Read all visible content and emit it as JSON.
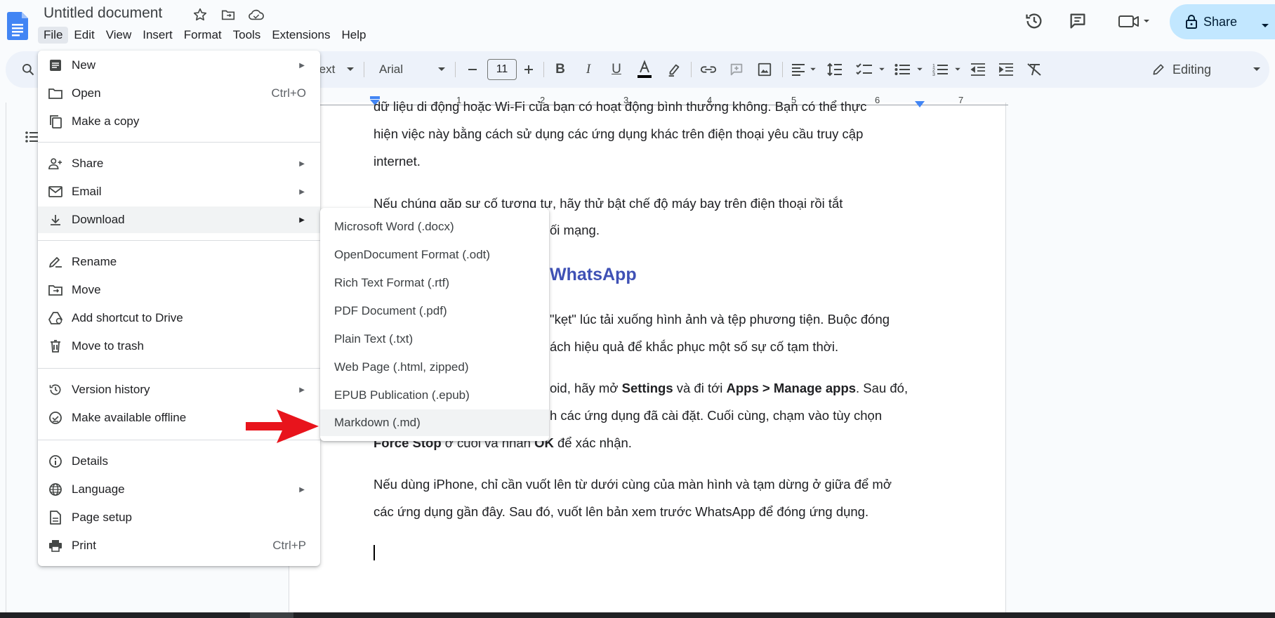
{
  "header": {
    "doc_title": "Untitled document",
    "menus": [
      "File",
      "Edit",
      "View",
      "Insert",
      "Format",
      "Tools",
      "Extensions",
      "Help"
    ],
    "share_label": "Share"
  },
  "toolbar": {
    "style_partial": "ext",
    "font_name": "Arial",
    "font_size": "11",
    "editing_label": "Editing"
  },
  "ruler": {
    "numbers": [
      "1",
      "2",
      "3",
      "4",
      "5",
      "6",
      "7"
    ]
  },
  "file_menu": {
    "items": [
      {
        "label": "New",
        "icon": "document-icon",
        "submenu": true
      },
      {
        "label": "Open",
        "icon": "folder-icon",
        "shortcut": "Ctrl+O"
      },
      {
        "label": "Make a copy",
        "icon": "copy-icon"
      },
      {
        "label": "Share",
        "icon": "person-add-icon",
        "submenu": true
      },
      {
        "label": "Email",
        "icon": "email-icon",
        "submenu": true
      },
      {
        "label": "Download",
        "icon": "download-icon",
        "submenu": true
      },
      {
        "label": "Rename",
        "icon": "rename-icon"
      },
      {
        "label": "Move",
        "icon": "move-folder-icon"
      },
      {
        "label": "Add shortcut to Drive",
        "icon": "drive-shortcut-icon"
      },
      {
        "label": "Move to trash",
        "icon": "trash-icon"
      },
      {
        "label": "Version history",
        "icon": "history-icon",
        "submenu": true
      },
      {
        "label": "Make available offline",
        "icon": "offline-icon"
      },
      {
        "label": "Details",
        "icon": "info-icon"
      },
      {
        "label": "Language",
        "icon": "globe-icon",
        "submenu": true
      },
      {
        "label": "Page setup",
        "icon": "page-icon"
      },
      {
        "label": "Print",
        "icon": "print-icon",
        "shortcut": "Ctrl+P"
      }
    ]
  },
  "download_menu": {
    "items": [
      "Microsoft Word (.docx)",
      "OpenDocument Format (.odt)",
      "Rich Text Format (.rtf)",
      "PDF Document (.pdf)",
      "Plain Text (.txt)",
      "Web Page (.html, zipped)",
      "EPUB Publication (.epub)",
      "Markdown (.md)"
    ]
  },
  "document": {
    "line1": "dữ liệu di động hoặc Wi-Fi của bạn có hoạt động bình thường không. Bạn có thể thực",
    "line2": "hiện việc này bằng cách sử dụng các ứng dụng khác trên điện thoại yêu cầu truy cập",
    "line3": "internet.",
    "line4": "Nếu chúng gặp sự cố tương tự, hãy thử bật chế độ máy bay trên điện thoại rồi tắt",
    "line5": "ối mạng.",
    "heading": "WhatsApp",
    "line6": "\"kẹt\" lúc tải xuống hình ảnh và tệp phương tiện. Buộc đóng",
    "line7": "ách hiệu quả để khắc phục một số sự cố tạm thời.",
    "line8_a": "oid, hãy mở ",
    "line8_b": "Settings",
    "line8_c": " và đi tới ",
    "line8_d": "Apps > Manage apps",
    "line8_e": ". Sau đó,",
    "line9": "h các ứng dụng đã cài đặt. Cuối cùng, chạm vào tùy chọn",
    "line10_a": "Force Stop",
    "line10_b": " ở cuối và nhấn ",
    "line10_c": "OK",
    "line10_d": " để xác nhận.",
    "line11": "Nếu dùng iPhone, chỉ cần vuốt lên từ dưới cùng của màn hình và tạm dừng ở giữa để mở",
    "line12": "các ứng dụng gần đây. Sau đó, vuốt lên bản xem trước WhatsApp để đóng ứng dụng."
  },
  "colors": {
    "accent": "#1a73e8",
    "share_bg": "#c2e7ff",
    "heading": "#3f51b5",
    "annotation_arrow": "#e8141c"
  }
}
